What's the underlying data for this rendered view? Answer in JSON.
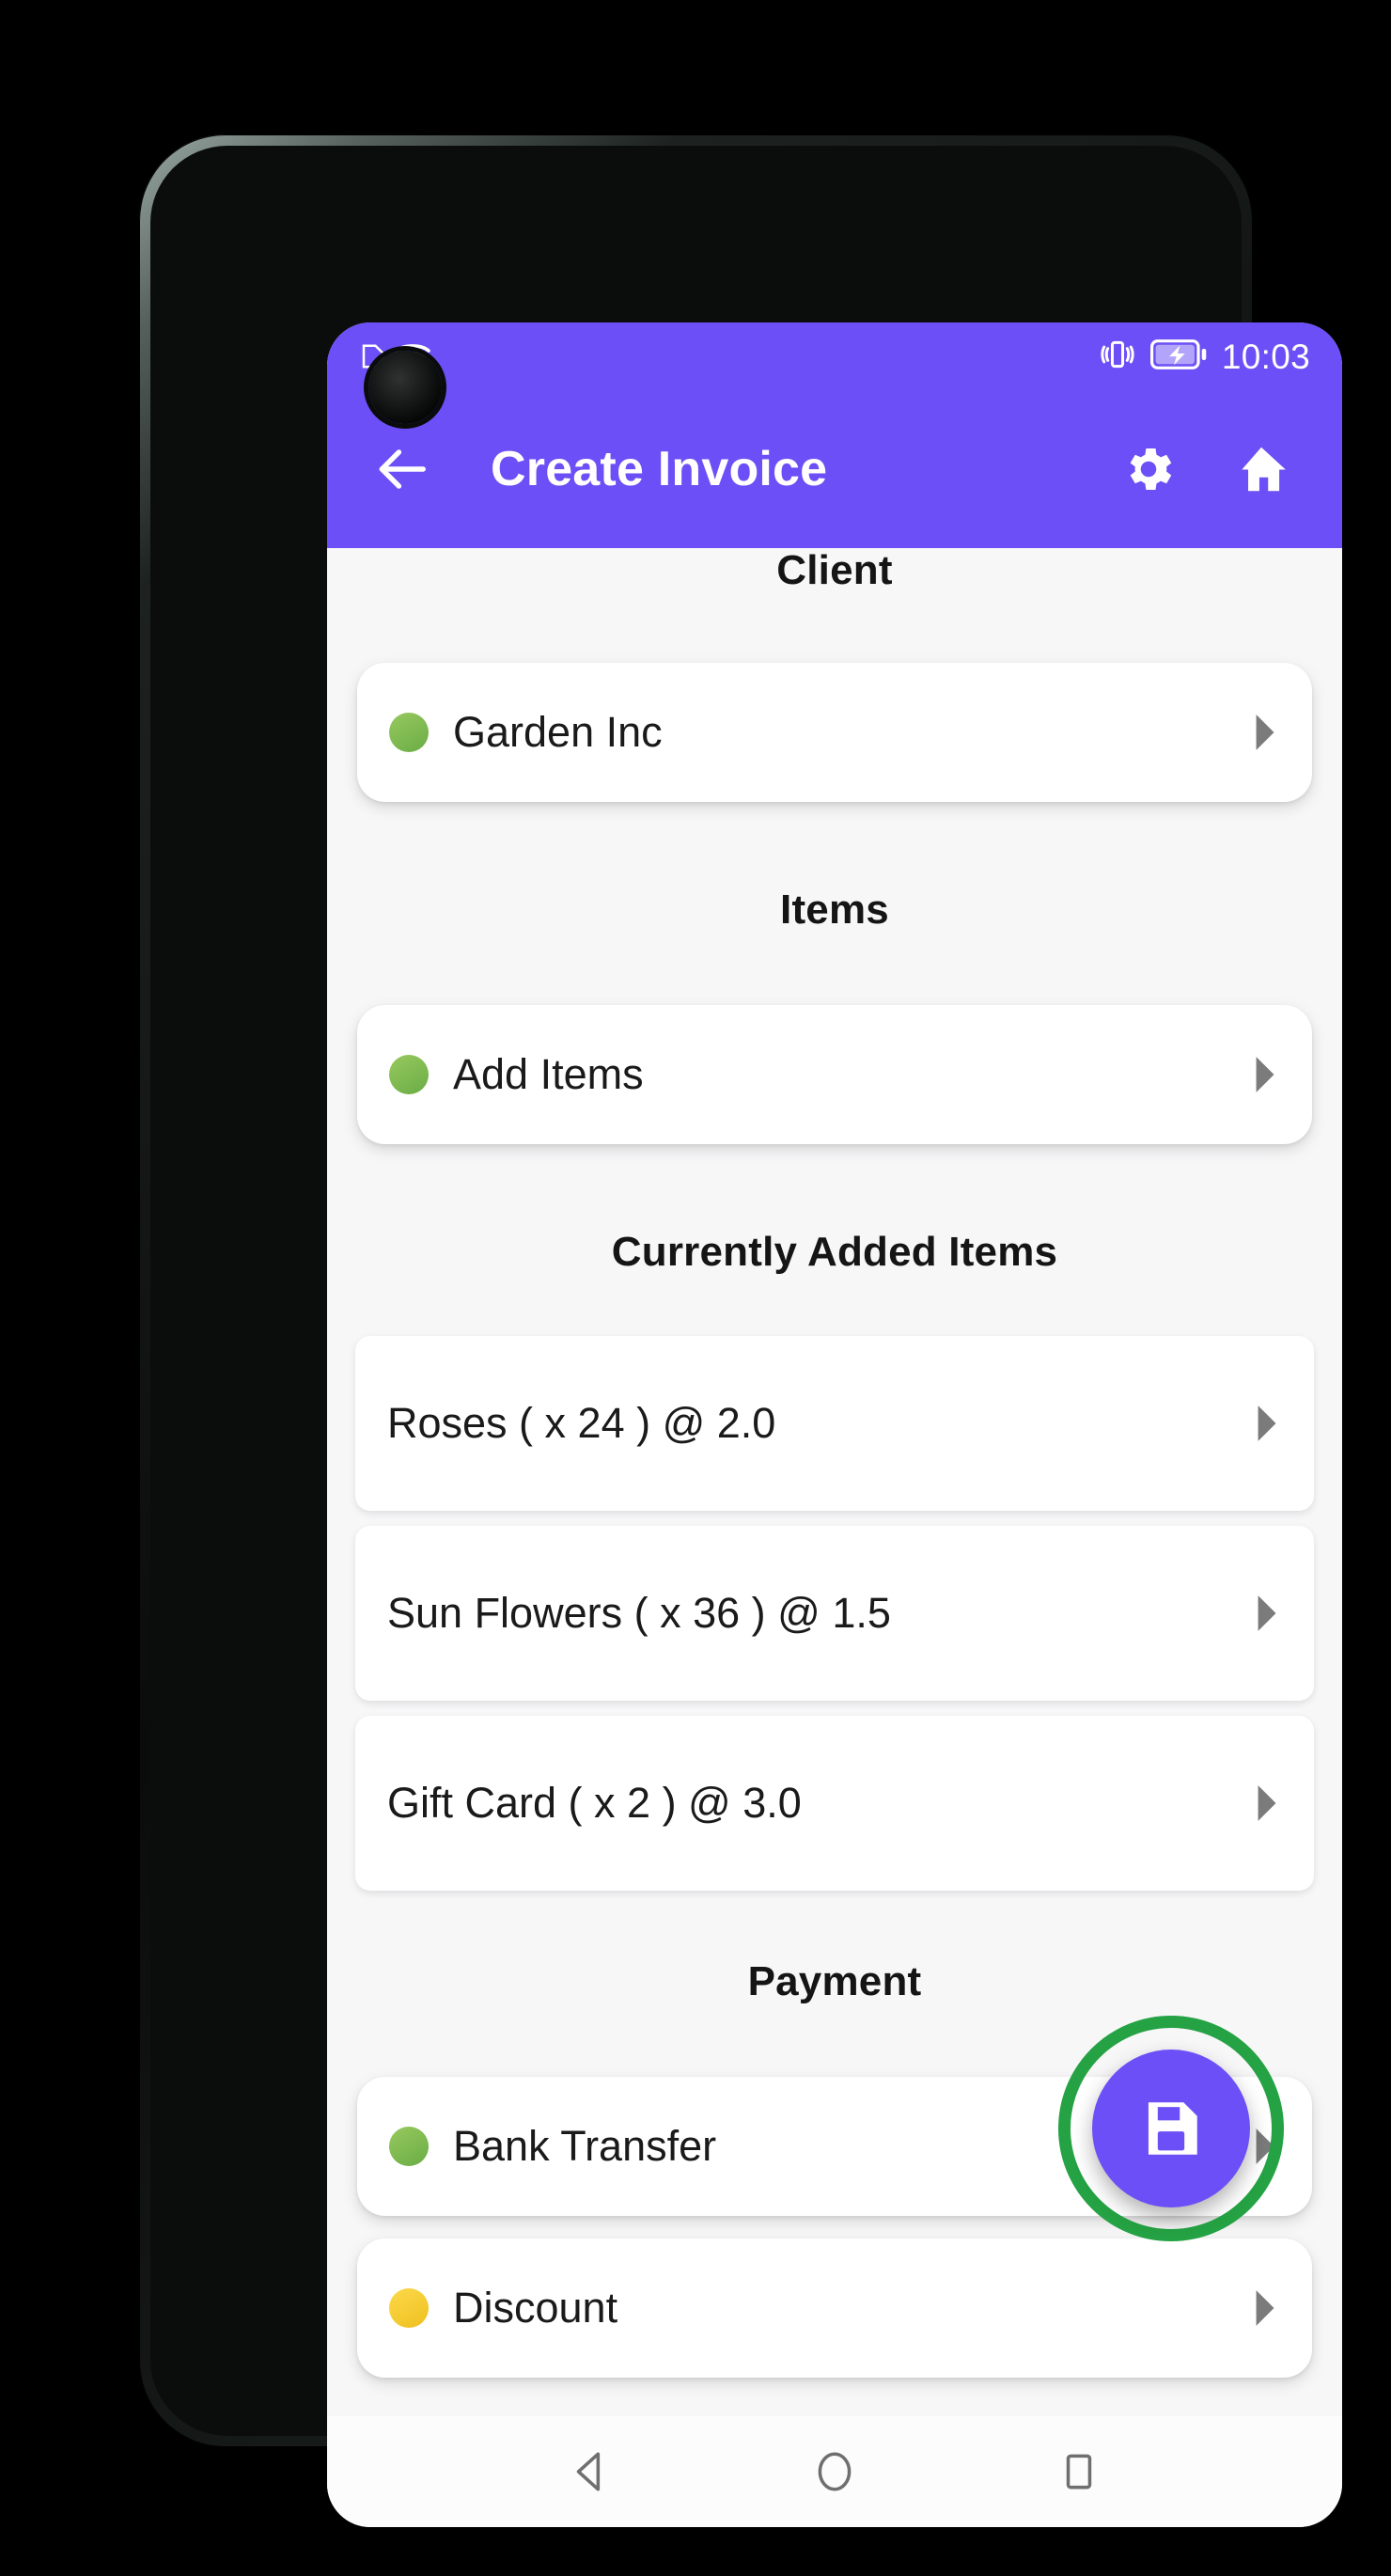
{
  "theme": {
    "primary": "#6c4ff6",
    "highlight_ring": "#25a244",
    "background": "#f7f7f8",
    "card": "#ffffff",
    "dot_green": "#6aad45",
    "dot_yellow": "#efc01f"
  },
  "status_bar": {
    "time": "10:03",
    "icons": [
      "nfc-icon",
      "wifi-icon",
      "vibrate-icon",
      "battery-charging-icon"
    ]
  },
  "app_bar": {
    "title": "Create Invoice",
    "back_icon": "arrow-left-icon",
    "settings_icon": "gear-icon",
    "home_icon": "home-icon"
  },
  "sections": {
    "client": {
      "header": "Client",
      "row": {
        "label": "Garden Inc",
        "dot": "green",
        "chevron": "chevron-right-icon"
      }
    },
    "items": {
      "header": "Items",
      "add_row": {
        "label": "Add Items",
        "dot": "green",
        "chevron": "chevron-right-icon"
      },
      "current_header": "Currently Added Items",
      "current_items": [
        {
          "label": "Roses ( x 24 ) @ 2.0",
          "chevron": "chevron-right-icon"
        },
        {
          "label": "Sun Flowers ( x 36 ) @ 1.5",
          "chevron": "chevron-right-icon"
        },
        {
          "label": "Gift Card ( x 2 ) @ 3.0",
          "chevron": "chevron-right-icon"
        }
      ]
    },
    "payment": {
      "header": "Payment",
      "rows": [
        {
          "label": "Bank Transfer",
          "dot": "green",
          "chevron": "chevron-right-icon"
        },
        {
          "label": "Discount",
          "dot": "yellow",
          "chevron": "chevron-right-icon"
        }
      ]
    }
  },
  "fab": {
    "icon": "save-icon",
    "highlighted": true
  },
  "nav_bar": {
    "back": "triangle-back-icon",
    "home": "circle-home-icon",
    "recents": "square-recents-icon"
  }
}
